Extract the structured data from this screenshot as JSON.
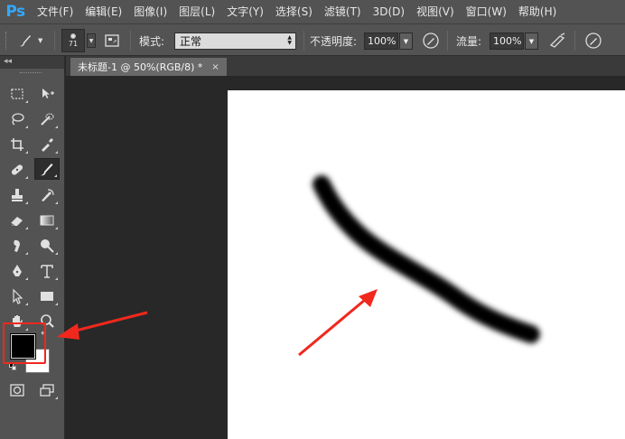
{
  "app": {
    "logo": "Ps",
    "menu": [
      "文件(F)",
      "编辑(E)",
      "图像(I)",
      "图层(L)",
      "文字(Y)",
      "选择(S)",
      "滤镜(T)",
      "3D(D)",
      "视图(V)",
      "窗口(W)",
      "帮助(H)"
    ]
  },
  "options": {
    "brush_size": "71",
    "mode_label": "模式:",
    "mode_value": "正常",
    "opacity_label": "不透明度:",
    "opacity_value": "100%",
    "flow_label": "流量:",
    "flow_value": "100%"
  },
  "document": {
    "tab_title": "未标题-1 @ 50%(RGB/8) *",
    "close": "×"
  },
  "colors": {
    "foreground": "#000000",
    "background": "#ffffff",
    "annotation": "#f0281e",
    "brand": "#31a8ff"
  },
  "toolbar": {
    "collapse": "◂◂",
    "icons": [
      "marquee-icon",
      "move-icon",
      "lasso-icon",
      "quick-select-icon",
      "crop-icon",
      "eyedropper-icon",
      "healing-icon",
      "brush-icon",
      "stamp-icon",
      "history-brush-icon",
      "eraser-icon",
      "gradient-icon",
      "smudge-icon",
      "dodge-icon",
      "pen-icon",
      "type-icon",
      "path-select-icon",
      "rectangle-icon",
      "hand-icon",
      "zoom-icon",
      "quick-mask-icon",
      "screen-mode-icon"
    ]
  }
}
